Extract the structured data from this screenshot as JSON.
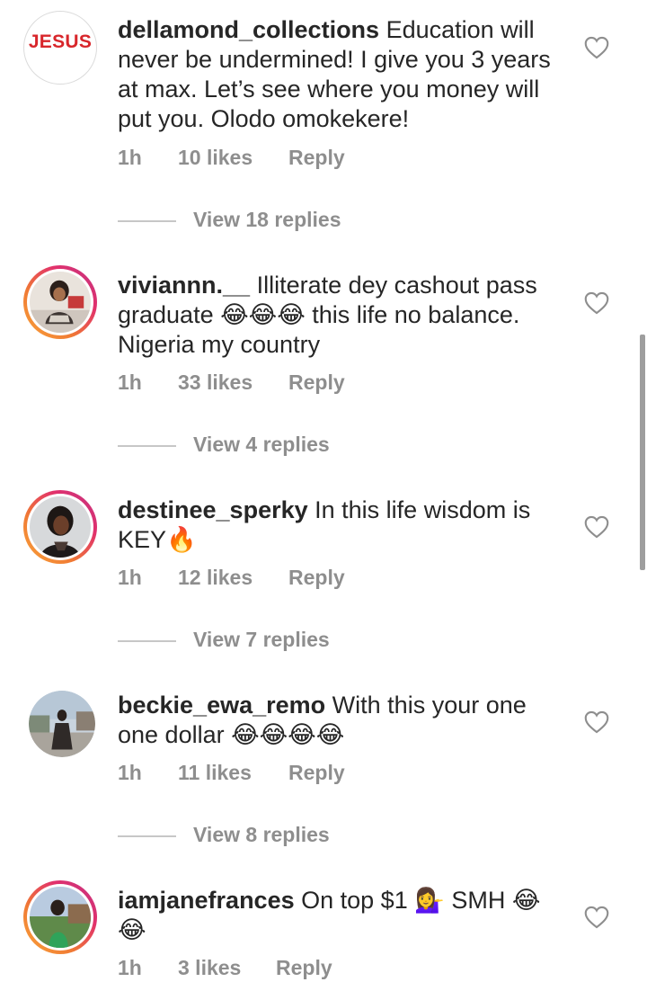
{
  "comments": [
    {
      "username": "dellamond_collections",
      "text": "Education will never be undermined!  I give you 3 years at max. Let’s see where you money will put you.  Olodo omokekere!",
      "time": "1h",
      "likes": "10 likes",
      "reply": "Reply",
      "view_replies": "View 18 replies",
      "avatar_label": "JESUS"
    },
    {
      "username": "viviannn.__",
      "text": "Illiterate dey cashout pass graduate 😂😂😂 this life no balance. Nigeria my country",
      "time": "1h",
      "likes": "33 likes",
      "reply": "Reply",
      "view_replies": "View 4 replies"
    },
    {
      "username": "destinee_sperky",
      "text": "In this life wisdom is KEY🔥",
      "time": "1h",
      "likes": "12 likes",
      "reply": "Reply",
      "view_replies": "View 7 replies"
    },
    {
      "username": "beckie_ewa_remo",
      "text": "With this your one one dollar 😂😂😂😂",
      "time": "1h",
      "likes": "11 likes",
      "reply": "Reply",
      "view_replies": "View 8 replies"
    },
    {
      "username": "iamjanefrances",
      "text": "On top $1 💁‍♀️ SMH 😂😂",
      "time": "1h",
      "likes": "3 likes",
      "reply": "Reply"
    }
  ],
  "colors": {
    "text": "#262626",
    "secondary": "#8e8e8e",
    "logo_red": "#d8262b",
    "story_ring": "#e1306c"
  },
  "icons": {
    "like": "heart-outline-icon"
  }
}
